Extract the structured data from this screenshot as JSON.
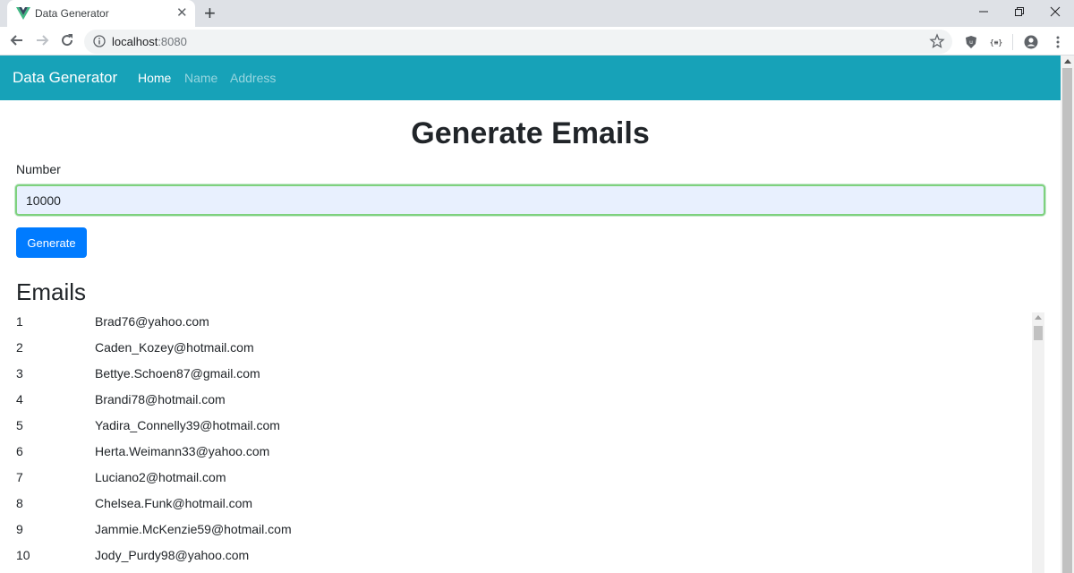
{
  "browser": {
    "tab_title": "Data Generator",
    "new_tab_symbol": "+",
    "close_symbol": "✕",
    "url_host": "localhost",
    "url_port": ":8080"
  },
  "navbar": {
    "brand": "Data Generator",
    "links": [
      {
        "label": "Home",
        "active": true
      },
      {
        "label": "Name",
        "active": false
      },
      {
        "label": "Address",
        "active": false
      }
    ]
  },
  "main": {
    "title": "Generate Emails",
    "number_label": "Number",
    "number_value": "10000",
    "generate_button": "Generate",
    "emails_heading": "Emails",
    "emails": [
      {
        "index": "1",
        "email": "Brad76@yahoo.com"
      },
      {
        "index": "2",
        "email": "Caden_Kozey@hotmail.com"
      },
      {
        "index": "3",
        "email": "Bettye.Schoen87@gmail.com"
      },
      {
        "index": "4",
        "email": "Brandi78@hotmail.com"
      },
      {
        "index": "5",
        "email": "Yadira_Connelly39@hotmail.com"
      },
      {
        "index": "6",
        "email": "Herta.Weimann33@yahoo.com"
      },
      {
        "index": "7",
        "email": "Luciano2@hotmail.com"
      },
      {
        "index": "8",
        "email": "Chelsea.Funk@hotmail.com"
      },
      {
        "index": "9",
        "email": "Jammie.McKenzie59@hotmail.com"
      },
      {
        "index": "10",
        "email": "Jody_Purdy98@yahoo.com"
      }
    ]
  },
  "colors": {
    "navbar_bg": "#17a2b8",
    "button_bg": "#007bff",
    "input_bg": "#e8f0fe",
    "input_border": "#7ed17e"
  },
  "icons": {
    "favicon": "vue-logo-icon",
    "back": "arrow-left-icon",
    "forward": "arrow-right-icon",
    "reload": "reload-icon",
    "info": "info-icon",
    "bookmark": "star-icon",
    "extensions": [
      "shield-extension-icon",
      "json-extension-icon"
    ],
    "profile": "account-icon",
    "menu": "kebab-menu-icon"
  }
}
